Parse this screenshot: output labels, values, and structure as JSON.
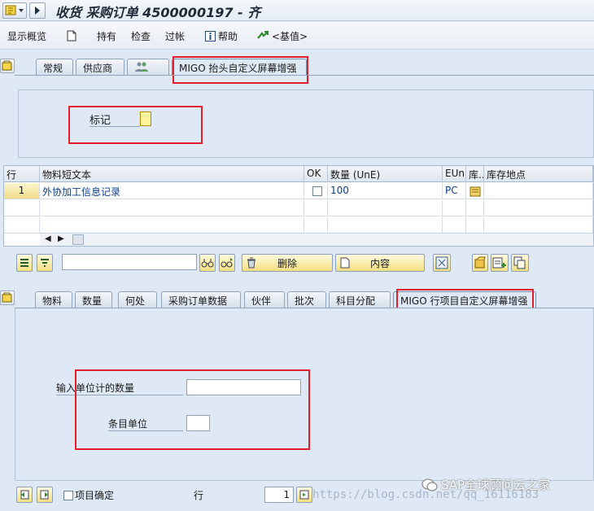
{
  "window": {
    "title": "收货 采购订单 4500000197 - 齐"
  },
  "toolbar": {
    "display_overview": "显示概览",
    "hold": "持有",
    "check": "检查",
    "post": "过帐",
    "help": "帮助",
    "default_values": "<基值>"
  },
  "header_tabs": [
    {
      "label": "常规"
    },
    {
      "label": "供应商"
    },
    {
      "label": ""
    },
    {
      "label": "MIGO 抬头自定义屏幕增强"
    }
  ],
  "header_panel": {
    "mark_label": "标记",
    "mark_value": ""
  },
  "item_table": {
    "columns": [
      "行",
      "物料短文本",
      "OK",
      "数量 (UnE)",
      "EUn",
      "库..",
      "库存地点"
    ],
    "rows": [
      {
        "line": "1",
        "short_text": "外协加工信息记录",
        "ok": false,
        "qty": "100",
        "uom": "PC",
        "storage_location": ""
      }
    ]
  },
  "grid_toolbar": {
    "delete": "删除",
    "content": "内容",
    "search_value": ""
  },
  "item_tabs": [
    {
      "label": "物料"
    },
    {
      "label": "数量"
    },
    {
      "label": "何处"
    },
    {
      "label": "采购订单数据"
    },
    {
      "label": "伙伴"
    },
    {
      "label": "批次"
    },
    {
      "label": "科目分配"
    },
    {
      "label": "MIGO 行项目自定义屏幕增强"
    }
  ],
  "item_panel": {
    "qty_label": "输入单位计的数量",
    "qty_value": "",
    "unit_label": "条目单位",
    "unit_value": ""
  },
  "footer": {
    "item_ok_label": "项目确定",
    "line_label": "行",
    "line_value": "1"
  },
  "watermark": {
    "url": "https://blog.csdn.net/qq_16116183",
    "brand": "SAP全球顾问云之家"
  },
  "colors": {
    "highlight_red": "#e0202c",
    "link_blue": "#0b3f91",
    "background": "#dfe9f5"
  }
}
